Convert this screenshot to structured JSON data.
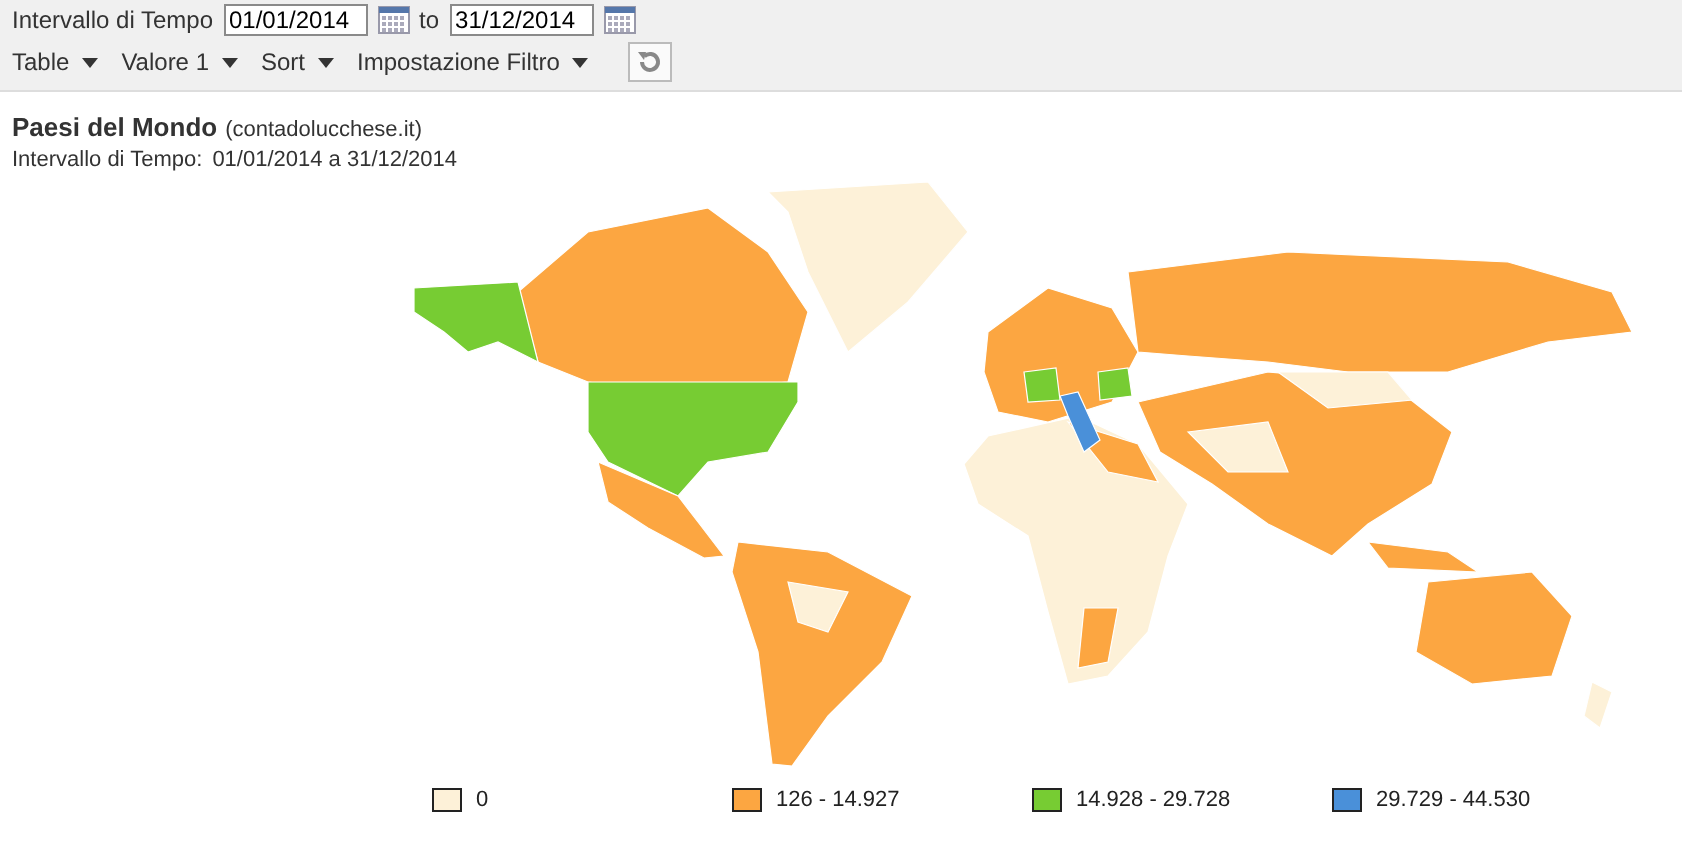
{
  "toolbar": {
    "range_label": "Intervallo di Tempo",
    "from_date": "01/01/2014",
    "to_label": "to",
    "to_date": "31/12/2014",
    "menus": [
      {
        "label": "Table"
      },
      {
        "label": "Valore 1"
      },
      {
        "label": "Sort"
      },
      {
        "label": "Impostazione Filtro"
      }
    ]
  },
  "report": {
    "title": "Paesi del Mondo",
    "source": "(contadolucchese.it)",
    "range_label": "Intervallo di Tempo:",
    "range_value": "01/01/2014 a 31/12/2014"
  },
  "legend": [
    {
      "label": "0",
      "color": "#fdf1d8"
    },
    {
      "label": "126 - 14.927",
      "color": "#fca641"
    },
    {
      "label": "14.928 - 29.728",
      "color": "#77cc33"
    },
    {
      "label": "29.729 - 44.530",
      "color": "#4a90d9"
    }
  ]
}
